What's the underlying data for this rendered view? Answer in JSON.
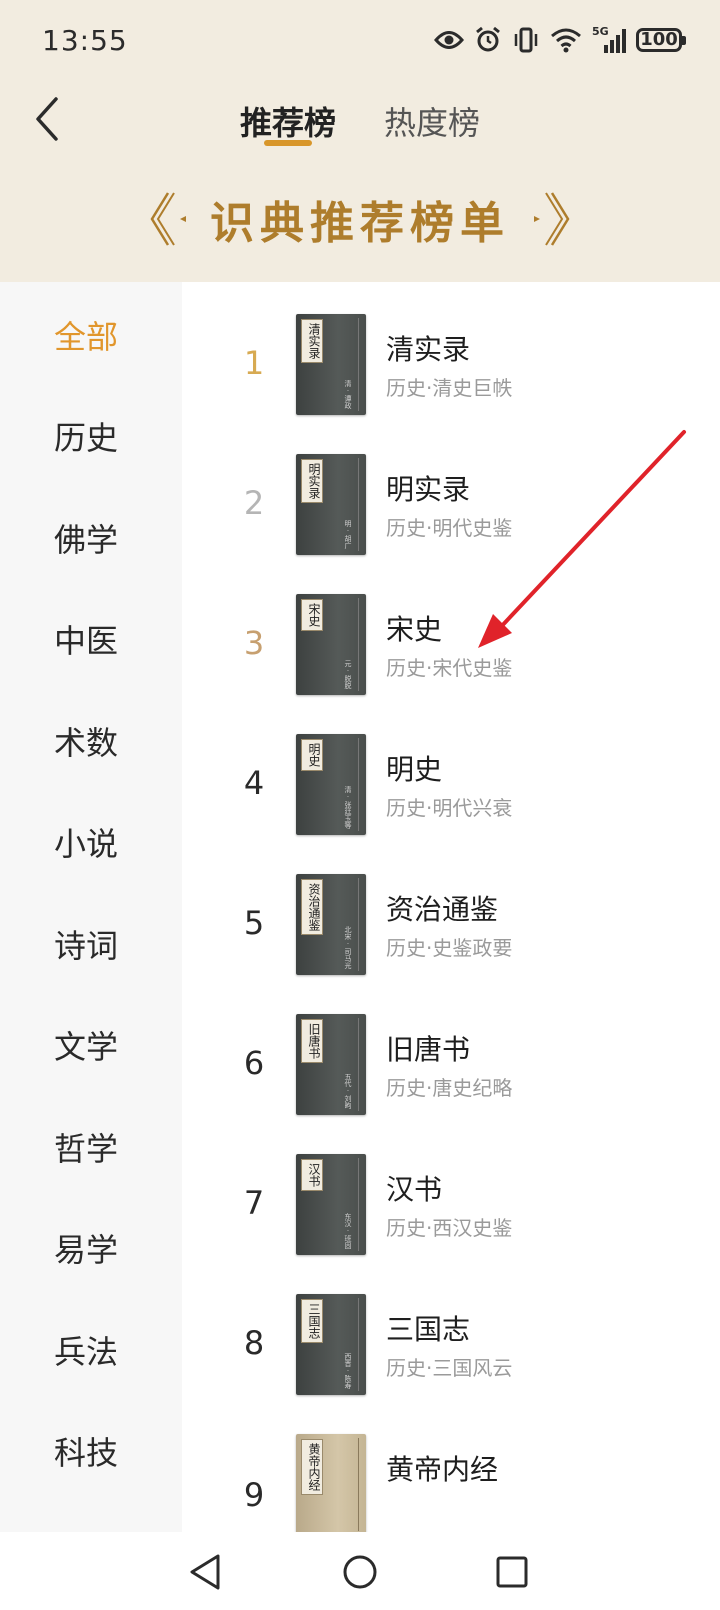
{
  "status": {
    "time": "13:55",
    "network": "5G",
    "battery": "100"
  },
  "header": {
    "tabs": [
      {
        "label": "推荐榜"
      },
      {
        "label": "热度榜"
      }
    ],
    "banner_title": "识典推荐榜单"
  },
  "sidebar": {
    "items": [
      {
        "label": "全部"
      },
      {
        "label": "历史"
      },
      {
        "label": "佛学"
      },
      {
        "label": "中医"
      },
      {
        "label": "术数"
      },
      {
        "label": "小说"
      },
      {
        "label": "诗词"
      },
      {
        "label": "文学"
      },
      {
        "label": "哲学"
      },
      {
        "label": "易学"
      },
      {
        "label": "兵法"
      },
      {
        "label": "科技"
      }
    ]
  },
  "books": [
    {
      "rank": "1",
      "title": "清实录",
      "subtitle": "历史·清史巨帙",
      "cover_title": "清实录",
      "cover_author": "清·谭政"
    },
    {
      "rank": "2",
      "title": "明实录",
      "subtitle": "历史·明代史鉴",
      "cover_title": "明实录",
      "cover_author": "明·胡广"
    },
    {
      "rank": "3",
      "title": "宋史",
      "subtitle": "历史·宋代史鉴",
      "cover_title": "宋史",
      "cover_author": "元·脱脱"
    },
    {
      "rank": "4",
      "title": "明史",
      "subtitle": "历史·明代兴衰",
      "cover_title": "明史",
      "cover_author": "清·张廷玉等"
    },
    {
      "rank": "5",
      "title": "资治通鉴",
      "subtitle": "历史·史鉴政要",
      "cover_title": "资治通鉴",
      "cover_author": "北宋·司马光"
    },
    {
      "rank": "6",
      "title": "旧唐书",
      "subtitle": "历史·唐史纪略",
      "cover_title": "旧唐书",
      "cover_author": "五代·刘昫"
    },
    {
      "rank": "7",
      "title": "汉书",
      "subtitle": "历史·西汉史鉴",
      "cover_title": "汉书",
      "cover_author": "东汉·班固"
    },
    {
      "rank": "8",
      "title": "三国志",
      "subtitle": "历史·三国风云",
      "cover_title": "三国志",
      "cover_author": "西晋·陈寿"
    },
    {
      "rank": "9",
      "title": "黄帝内经",
      "subtitle": "",
      "cover_title": "黄帝内经",
      "cover_author": ""
    }
  ],
  "colors": {
    "accent": "#e1962c",
    "banner": "#ae7d2c",
    "header_bg": "#f2ece0",
    "arrow": "#e0232a"
  }
}
